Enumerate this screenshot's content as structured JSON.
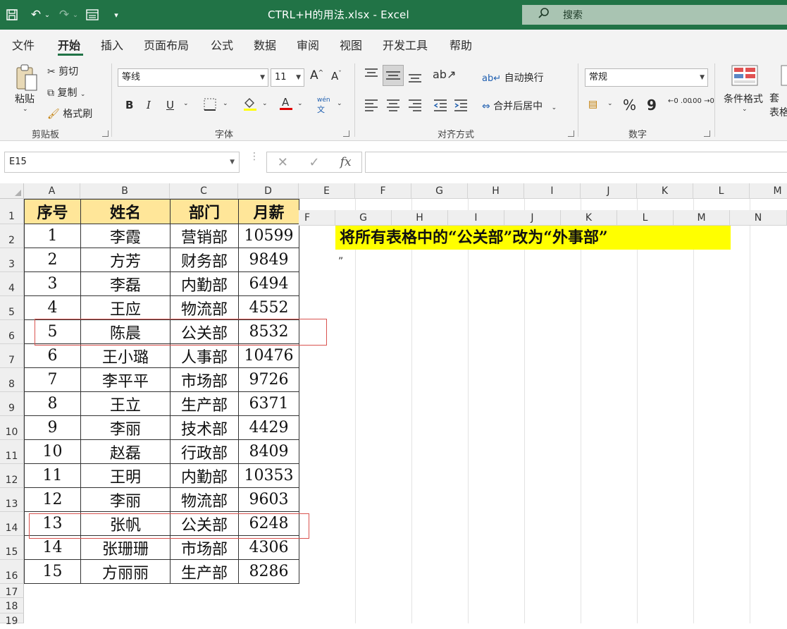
{
  "window": {
    "title": "CTRL+H的用法.xlsx  -  Excel",
    "search_label": "搜索"
  },
  "menu": {
    "tabs": [
      "文件",
      "开始",
      "插入",
      "页面布局",
      "公式",
      "数据",
      "审阅",
      "视图",
      "开发工具",
      "帮助"
    ],
    "active": "开始"
  },
  "ribbon": {
    "clipboard": {
      "paste": "粘贴",
      "cut": "剪切",
      "copy": "复制",
      "format_painter": "格式刷",
      "group": "剪贴板"
    },
    "font": {
      "name": "等线",
      "size": "11",
      "bold": "B",
      "italic": "I",
      "underline": "U",
      "wen": "wén",
      "wen2": "文",
      "group": "字体"
    },
    "alignment": {
      "wrap": "自动换行",
      "merge": "合并后居中",
      "group": "对齐方式"
    },
    "number": {
      "format": "常规",
      "percent": "%",
      "comma": "9",
      "inc": "←0 .00",
      "dec": ".00 →0",
      "group": "数字"
    },
    "styles": {
      "conditional": "条件格式",
      "table_format": "套\n表格"
    }
  },
  "formula_bar": {
    "name_box": "E15",
    "fx": "fx",
    "cancel": "✕",
    "enter": "✓",
    "content": ""
  },
  "grid": {
    "columns": [
      "A",
      "B",
      "C",
      "D",
      "E",
      "F",
      "G",
      "H",
      "I",
      "J",
      "K",
      "L",
      "M"
    ],
    "rows": [
      "1",
      "2",
      "3",
      "4",
      "5",
      "6",
      "7",
      "8",
      "9",
      "10",
      "11",
      "12",
      "13",
      "14",
      "15",
      "16",
      "17",
      "18",
      "19"
    ],
    "overlay_columns": [
      "F",
      "G",
      "H",
      "I",
      "J",
      "K",
      "L",
      "M",
      "N"
    ]
  },
  "table": {
    "headers": [
      "序号",
      "姓名",
      "部门",
      "月薪"
    ],
    "rows": [
      [
        "1",
        "李霞",
        "营销部",
        "10599"
      ],
      [
        "2",
        "方芳",
        "财务部",
        "9849"
      ],
      [
        "3",
        "李磊",
        "内勤部",
        "6494"
      ],
      [
        "4",
        "王应",
        "物流部",
        "4552"
      ],
      [
        "5",
        "陈晨",
        "公关部",
        "8532"
      ],
      [
        "6",
        "王小璐",
        "人事部",
        "10476"
      ],
      [
        "7",
        "李平平",
        "市场部",
        "9726"
      ],
      [
        "8",
        "王立",
        "生产部",
        "6371"
      ],
      [
        "9",
        "李丽",
        "技术部",
        "4429"
      ],
      [
        "10",
        "赵磊",
        "行政部",
        "8409"
      ],
      [
        "11",
        "王明",
        "内勤部",
        "10353"
      ],
      [
        "12",
        "李丽",
        "物流部",
        "9603"
      ],
      [
        "13",
        "张帆",
        "公关部",
        "6248"
      ],
      [
        "14",
        "张珊珊",
        "市场部",
        "4306"
      ],
      [
        "15",
        "方丽丽",
        "生产部",
        "8286"
      ]
    ]
  },
  "note": {
    "text": "将所有表格中的“公关部”改为“外事部”",
    "trailing": "”"
  },
  "colors": {
    "excel_green": "#217346",
    "header_fill": "#ffe699",
    "note_fill": "#ffff00",
    "highlight_border": "#d9534f"
  }
}
